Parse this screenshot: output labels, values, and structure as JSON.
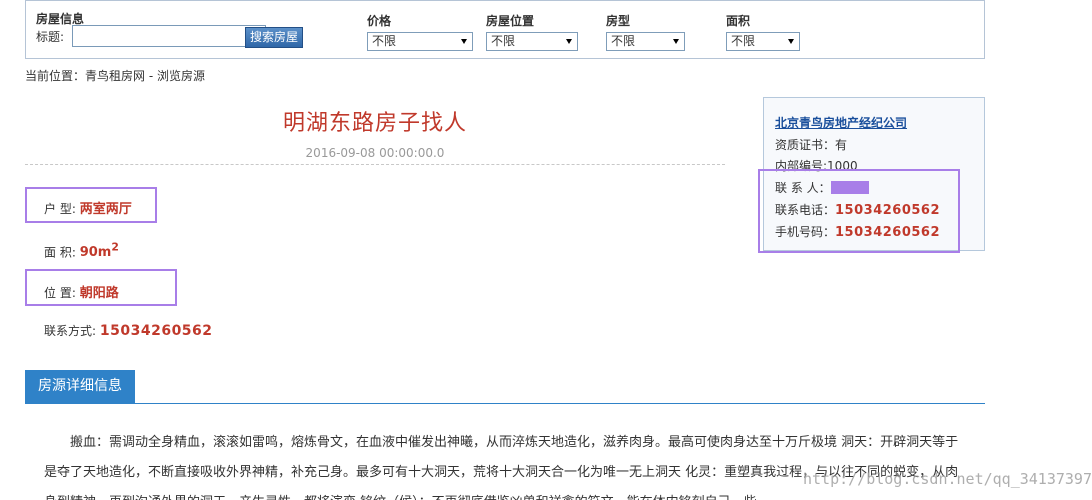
{
  "search": {
    "section_title": "房屋信息",
    "title_label": "标题:",
    "title_value": "",
    "search_button": "搜索房屋",
    "filters": [
      {
        "label": "价格",
        "selected": "不限"
      },
      {
        "label": "房屋位置",
        "selected": "不限"
      },
      {
        "label": "房型",
        "selected": "不限"
      },
      {
        "label": "面积",
        "selected": "不限"
      }
    ]
  },
  "breadcrumb": "当前位置：青鸟租房网 - 浏览房源",
  "listing": {
    "title": "明湖东路房子找人",
    "date": "2016-09-08 00:00:00.0",
    "layout_label": "户 型:",
    "layout_value": "两室两厅",
    "area_label": "面 积:",
    "area_value": "90m",
    "area_sup": "2",
    "location_label": "位 置:",
    "location_value": "朝阳路",
    "contact_label": "联系方式:",
    "contact_value": "15034260562"
  },
  "agency": {
    "name": "北京青鸟房地产经纪公司",
    "certificate": "资质证书：有",
    "internal_id": "内部编号:1000",
    "contact_person_label": "联 系 人：",
    "phone_label": "联系电话：",
    "phone": "15034260562",
    "mobile_label": "手机号码：",
    "mobile": "15034260562"
  },
  "details": {
    "tab_label": "房源详细信息",
    "text": "搬血：需调动全身精血，滚滚如雷鸣，熔炼骨文，在血液中催发出神曦，从而淬炼天地造化，滋养肉身。最高可使肉身达至十万斤极境 洞天：开辟洞天等于是夺了天地造化，不断直接吸收外界神精，补充己身。最多可有十大洞天，荒将十大洞天合一化为唯一无上洞天 化灵：重塑真我过程，与以往不同的蜕变，从肉身到精神，再到沟通外界的洞天，产生灵性，都将演变 铭纹（候）：不再彻底借鉴凶兽和祥禽的符文，能在体内铭刻自己一些"
  },
  "watermark": "http://blog.csdn.net/qq_34137397",
  "colors": {
    "accent_red": "#c0392b",
    "tab_blue": "#2f82c8",
    "highlight_purple": "#a87ee8",
    "link_blue": "#1a4f9c"
  }
}
